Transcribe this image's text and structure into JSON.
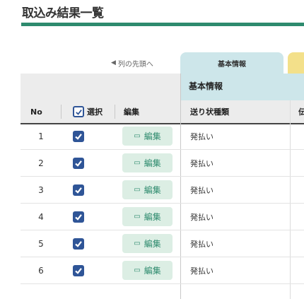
{
  "page": {
    "title": "取込み結果一覧"
  },
  "nav": {
    "prev_label": "列の先頭へ",
    "prev_arrow": "◀"
  },
  "tabs": [
    {
      "label": "基本情報"
    }
  ],
  "group_header": {
    "label": "基本情報"
  },
  "columns": {
    "no": "No",
    "select": "選択",
    "edit": "編集",
    "transfer_status": "送り状種類",
    "overflow": "伝"
  },
  "edit_button": {
    "label": "編集",
    "icon": "edit-icon"
  },
  "rows": [
    {
      "no": "1",
      "checked": true,
      "status": "発払い"
    },
    {
      "no": "2",
      "checked": true,
      "status": "発払い"
    },
    {
      "no": "3",
      "checked": true,
      "status": "発払い"
    },
    {
      "no": "4",
      "checked": true,
      "status": "発払い"
    },
    {
      "no": "5",
      "checked": true,
      "status": "発払い"
    },
    {
      "no": "6",
      "checked": true,
      "status": "発払い"
    }
  ],
  "colors": {
    "accent": "#2e8b6e",
    "checkbox": "#2f5597",
    "tab_active": "#cde6ea",
    "tab_next": "#f3e08a",
    "edit_bg": "#dceee4"
  }
}
